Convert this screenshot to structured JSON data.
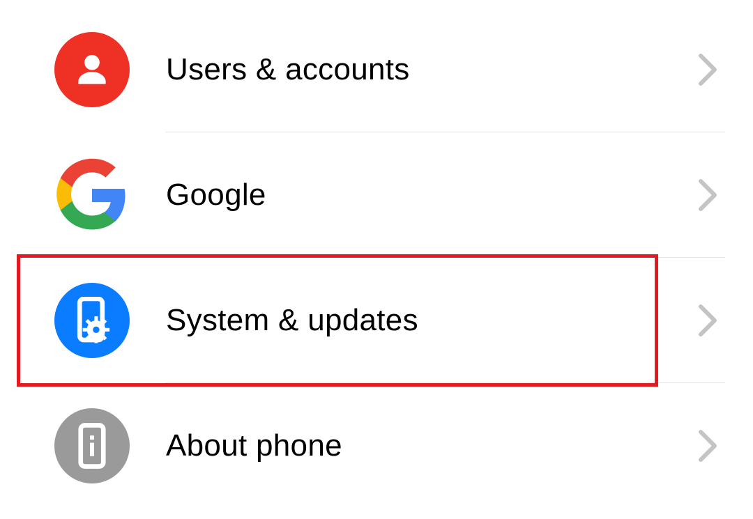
{
  "settings": {
    "items": [
      {
        "label": "Users & accounts",
        "icon": "user-icon",
        "bg": "#ee3124",
        "highlighted": false
      },
      {
        "label": "Google",
        "icon": "google-icon",
        "bg": "none",
        "highlighted": false
      },
      {
        "label": "System & updates",
        "icon": "phone-gear-icon",
        "bg": "#0a7cff",
        "highlighted": true
      },
      {
        "label": "About phone",
        "icon": "phone-info-icon",
        "bg": "#9a9a9a",
        "highlighted": false
      }
    ]
  },
  "colors": {
    "highlight_border": "#e21b22",
    "chevron": "#c4c4c4",
    "divider": "#e3e3e3"
  }
}
